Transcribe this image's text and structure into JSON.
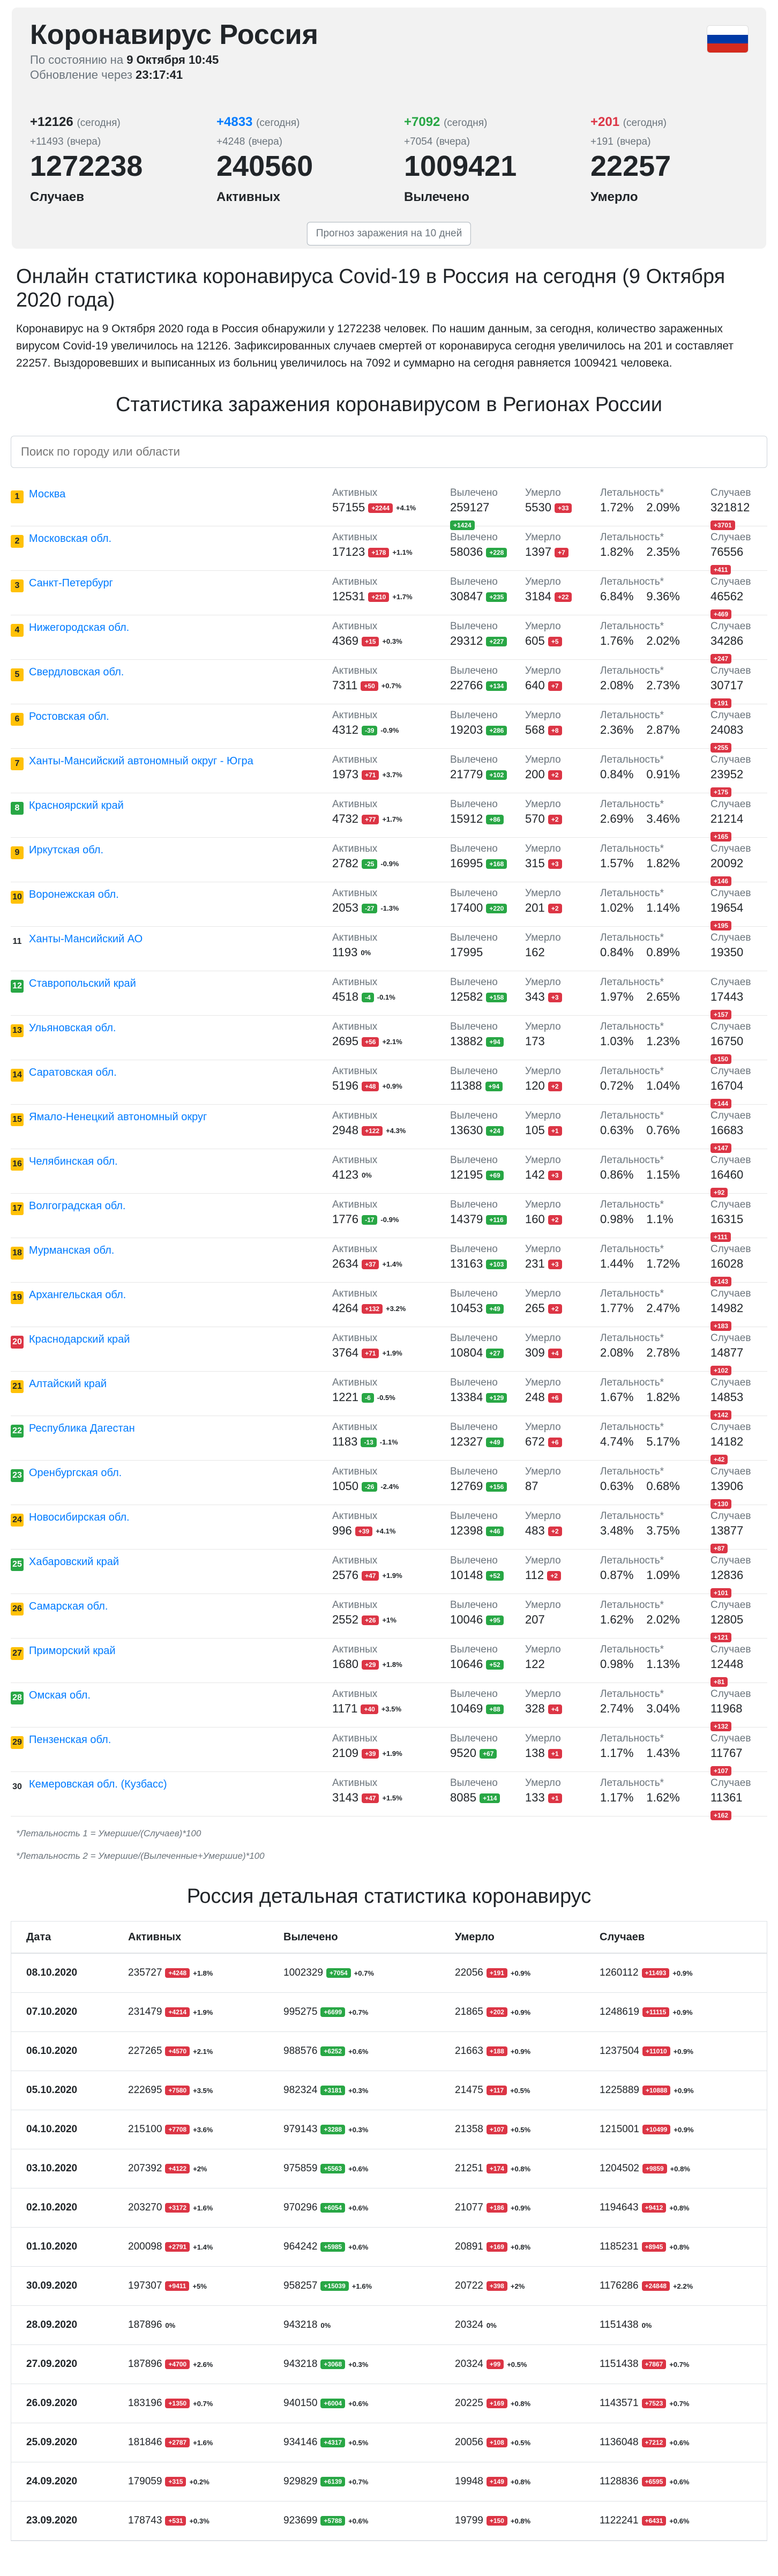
{
  "header": {
    "title": "Коронавирус Россия",
    "asof_prefix": "По состоянию на",
    "asof_value": "9 Октября 10:45",
    "update_prefix": "Обновление через",
    "update_value": "23:17:41",
    "forecast_button": "Прогноз заражения на 10 дней"
  },
  "summary": [
    {
      "today": "+12126",
      "today_lbl": "(сегодня)",
      "yday": "+11493",
      "yday_lbl": "(вчера)",
      "total": "1272238",
      "label": "Случаев",
      "color": "dark"
    },
    {
      "today": "+4833",
      "today_lbl": "(сегодня)",
      "yday": "+4248",
      "yday_lbl": "(вчера)",
      "total": "240560",
      "label": "Активных",
      "color": "blue"
    },
    {
      "today": "+7092",
      "today_lbl": "(сегодня)",
      "yday": "+7054",
      "yday_lbl": "(вчера)",
      "total": "1009421",
      "label": "Вылечено",
      "color": "green"
    },
    {
      "today": "+201",
      "today_lbl": "(сегодня)",
      "yday": "+191",
      "yday_lbl": "(вчера)",
      "total": "22257",
      "label": "Умерло",
      "color": "red"
    }
  ],
  "article": {
    "heading": "Онлайн статистика коронавируса Covid-19 в Россия на сегодня (9 Октября 2020 года)",
    "body": "Коронавирус на 9 Октября 2020 года в Россия обнаружили у 1272238 человек. По нашим данным, за сегодня, количество зараженных вирусом Covid-19 увеличилось на 12126. Зафиксированных случаев смертей от коронавируса сегодня увеличилось на 201 и составляет 22257. Выздоровевших и выписанных из больниц увеличилось на 7092 и суммарно на сегодня равняется 1009421 человека."
  },
  "regions_title": "Статистика заражения коронавирусом в Регионах России",
  "search": {
    "placeholder": "Поиск по городу или области"
  },
  "region_headers": {
    "active": "Активных",
    "recovered": "Вылечено",
    "deaths": "Умерло",
    "lethality": "Летальность*",
    "cases": "Случаев"
  },
  "regions": [
    {
      "n": "1",
      "name": "Москва",
      "active": "57155",
      "active_d": "+2244",
      "active_p": "+4.1%",
      "rec": "259127",
      "rec_d": "+1424",
      "deaths": "5530",
      "deaths_d": "+33",
      "l1": "1.72%",
      "l2": "2.09%",
      "cases": "321812",
      "cases_d": "+3701",
      "badge": "yellow"
    },
    {
      "n": "2",
      "name": "Московская обл.",
      "active": "17123",
      "active_d": "+178",
      "active_p": "+1.1%",
      "rec": "58036",
      "rec_d": "+228",
      "deaths": "1397",
      "deaths_d": "+7",
      "l1": "1.82%",
      "l2": "2.35%",
      "cases": "76556",
      "cases_d": "+411",
      "badge": "yellow"
    },
    {
      "n": "3",
      "name": "Санкт-Петербург",
      "active": "12531",
      "active_d": "+210",
      "active_p": "+1.7%",
      "rec": "30847",
      "rec_d": "+235",
      "deaths": "3184",
      "deaths_d": "+22",
      "l1": "6.84%",
      "l2": "9.36%",
      "cases": "46562",
      "cases_d": "+469",
      "badge": "yellow"
    },
    {
      "n": "4",
      "name": "Нижегородская обл.",
      "active": "4369",
      "active_d": "+15",
      "active_p": "+0.3%",
      "rec": "29312",
      "rec_d": "+227",
      "deaths": "605",
      "deaths_d": "+5",
      "l1": "1.76%",
      "l2": "2.02%",
      "cases": "34286",
      "cases_d": "+247",
      "badge": "yellow"
    },
    {
      "n": "5",
      "name": "Свердловская обл.",
      "active": "7311",
      "active_d": "+50",
      "active_p": "+0.7%",
      "rec": "22766",
      "rec_d": "+134",
      "deaths": "640",
      "deaths_d": "+7",
      "l1": "2.08%",
      "l2": "2.73%",
      "cases": "30717",
      "cases_d": "+191",
      "badge": "yellow"
    },
    {
      "n": "6",
      "name": "Ростовская обл.",
      "active": "4312",
      "active_d": "-39",
      "active_p": "-0.9%",
      "rec": "19203",
      "rec_d": "+286",
      "deaths": "568",
      "deaths_d": "+8",
      "l1": "2.36%",
      "l2": "2.87%",
      "cases": "24083",
      "cases_d": "+255",
      "badge": "yellow"
    },
    {
      "n": "7",
      "name": "Ханты-Мансийский автономный округ - Югра",
      "active": "1973",
      "active_d": "+71",
      "active_p": "+3.7%",
      "rec": "21779",
      "rec_d": "+102",
      "deaths": "200",
      "deaths_d": "+2",
      "l1": "0.84%",
      "l2": "0.91%",
      "cases": "23952",
      "cases_d": "+175",
      "badge": "yellow"
    },
    {
      "n": "8",
      "name": "Красноярский край",
      "active": "4732",
      "active_d": "+77",
      "active_p": "+1.7%",
      "rec": "15912",
      "rec_d": "+86",
      "deaths": "570",
      "deaths_d": "+2",
      "l1": "2.69%",
      "l2": "3.46%",
      "cases": "21214",
      "cases_d": "+165",
      "badge": "green"
    },
    {
      "n": "9",
      "name": "Иркутская обл.",
      "active": "2782",
      "active_d": "-25",
      "active_p": "-0.9%",
      "rec": "16995",
      "rec_d": "+168",
      "deaths": "315",
      "deaths_d": "+3",
      "l1": "1.57%",
      "l2": "1.82%",
      "cases": "20092",
      "cases_d": "+146",
      "badge": "yellow"
    },
    {
      "n": "10",
      "name": "Воронежская обл.",
      "active": "2053",
      "active_d": "-27",
      "active_p": "-1.3%",
      "rec": "17400",
      "rec_d": "+220",
      "deaths": "201",
      "deaths_d": "+2",
      "l1": "1.02%",
      "l2": "1.14%",
      "cases": "19654",
      "cases_d": "+195",
      "badge": "yellow"
    },
    {
      "n": "11",
      "name": "Ханты-Мансийский АО",
      "active": "1193",
      "active_d": "",
      "active_p": "0%",
      "rec": "17995",
      "rec_d": "",
      "deaths": "162",
      "deaths_d": "",
      "l1": "0.84%",
      "l2": "0.89%",
      "cases": "19350",
      "cases_d": "",
      "badge": "none"
    },
    {
      "n": "12",
      "name": "Ставропольский край",
      "active": "4518",
      "active_d": "-4",
      "active_p": "-0.1%",
      "rec": "12582",
      "rec_d": "+158",
      "deaths": "343",
      "deaths_d": "+3",
      "l1": "1.97%",
      "l2": "2.65%",
      "cases": "17443",
      "cases_d": "+157",
      "badge": "green"
    },
    {
      "n": "13",
      "name": "Ульяновская обл.",
      "active": "2695",
      "active_d": "+56",
      "active_p": "+2.1%",
      "rec": "13882",
      "rec_d": "+94",
      "deaths": "173",
      "deaths_d": "",
      "l1": "1.03%",
      "l2": "1.23%",
      "cases": "16750",
      "cases_d": "+150",
      "badge": "yellow"
    },
    {
      "n": "14",
      "name": "Саратовская обл.",
      "active": "5196",
      "active_d": "+48",
      "active_p": "+0.9%",
      "rec": "11388",
      "rec_d": "+94",
      "deaths": "120",
      "deaths_d": "+2",
      "l1": "0.72%",
      "l2": "1.04%",
      "cases": "16704",
      "cases_d": "+144",
      "badge": "yellow"
    },
    {
      "n": "15",
      "name": "Ямало-Ненецкий автономный округ",
      "active": "2948",
      "active_d": "+122",
      "active_p": "+4.3%",
      "rec": "13630",
      "rec_d": "+24",
      "deaths": "105",
      "deaths_d": "+1",
      "l1": "0.63%",
      "l2": "0.76%",
      "cases": "16683",
      "cases_d": "+147",
      "badge": "yellow"
    },
    {
      "n": "16",
      "name": "Челябинская обл.",
      "active": "4123",
      "active_d": "",
      "active_p": "0%",
      "rec": "12195",
      "rec_d": "+69",
      "deaths": "142",
      "deaths_d": "+3",
      "l1": "0.86%",
      "l2": "1.15%",
      "cases": "16460",
      "cases_d": "+92",
      "badge": "yellow"
    },
    {
      "n": "17",
      "name": "Волгоградская обл.",
      "active": "1776",
      "active_d": "-17",
      "active_p": "-0.9%",
      "rec": "14379",
      "rec_d": "+116",
      "deaths": "160",
      "deaths_d": "+2",
      "l1": "0.98%",
      "l2": "1.1%",
      "cases": "16315",
      "cases_d": "+111",
      "badge": "yellow"
    },
    {
      "n": "18",
      "name": "Мурманская обл.",
      "active": "2634",
      "active_d": "+37",
      "active_p": "+1.4%",
      "rec": "13163",
      "rec_d": "+103",
      "deaths": "231",
      "deaths_d": "+3",
      "l1": "1.44%",
      "l2": "1.72%",
      "cases": "16028",
      "cases_d": "+143",
      "badge": "yellow"
    },
    {
      "n": "19",
      "name": "Архангельская обл.",
      "active": "4264",
      "active_d": "+132",
      "active_p": "+3.2%",
      "rec": "10453",
      "rec_d": "+49",
      "deaths": "265",
      "deaths_d": "+2",
      "l1": "1.77%",
      "l2": "2.47%",
      "cases": "14982",
      "cases_d": "+183",
      "badge": "yellow"
    },
    {
      "n": "20",
      "name": "Краснодарский край",
      "active": "3764",
      "active_d": "+71",
      "active_p": "+1.9%",
      "rec": "10804",
      "rec_d": "+27",
      "deaths": "309",
      "deaths_d": "+4",
      "l1": "2.08%",
      "l2": "2.78%",
      "cases": "14877",
      "cases_d": "+102",
      "badge": "red"
    },
    {
      "n": "21",
      "name": "Алтайский край",
      "active": "1221",
      "active_d": "-6",
      "active_p": "-0.5%",
      "rec": "13384",
      "rec_d": "+129",
      "deaths": "248",
      "deaths_d": "+6",
      "l1": "1.67%",
      "l2": "1.82%",
      "cases": "14853",
      "cases_d": "+142",
      "badge": "yellow"
    },
    {
      "n": "22",
      "name": "Республика Дагестан",
      "active": "1183",
      "active_d": "-13",
      "active_p": "-1.1%",
      "rec": "12327",
      "rec_d": "+49",
      "deaths": "672",
      "deaths_d": "+6",
      "l1": "4.74%",
      "l2": "5.17%",
      "cases": "14182",
      "cases_d": "+42",
      "badge": "green"
    },
    {
      "n": "23",
      "name": "Оренбургская обл.",
      "active": "1050",
      "active_d": "-26",
      "active_p": "-2.4%",
      "rec": "12769",
      "rec_d": "+156",
      "deaths": "87",
      "deaths_d": "",
      "l1": "0.63%",
      "l2": "0.68%",
      "cases": "13906",
      "cases_d": "+130",
      "badge": "green"
    },
    {
      "n": "24",
      "name": "Новосибирская обл.",
      "active": "996",
      "active_d": "+39",
      "active_p": "+4.1%",
      "rec": "12398",
      "rec_d": "+46",
      "deaths": "483",
      "deaths_d": "+2",
      "l1": "3.48%",
      "l2": "3.75%",
      "cases": "13877",
      "cases_d": "+87",
      "badge": "yellow"
    },
    {
      "n": "25",
      "name": "Хабаровский край",
      "active": "2576",
      "active_d": "+47",
      "active_p": "+1.9%",
      "rec": "10148",
      "rec_d": "+52",
      "deaths": "112",
      "deaths_d": "+2",
      "l1": "0.87%",
      "l2": "1.09%",
      "cases": "12836",
      "cases_d": "+101",
      "badge": "green"
    },
    {
      "n": "26",
      "name": "Самарская обл.",
      "active": "2552",
      "active_d": "+26",
      "active_p": "+1%",
      "rec": "10046",
      "rec_d": "+95",
      "deaths": "207",
      "deaths_d": "",
      "l1": "1.62%",
      "l2": "2.02%",
      "cases": "12805",
      "cases_d": "+121",
      "badge": "yellow"
    },
    {
      "n": "27",
      "name": "Приморский край",
      "active": "1680",
      "active_d": "+29",
      "active_p": "+1.8%",
      "rec": "10646",
      "rec_d": "+52",
      "deaths": "122",
      "deaths_d": "",
      "l1": "0.98%",
      "l2": "1.13%",
      "cases": "12448",
      "cases_d": "+81",
      "badge": "yellow"
    },
    {
      "n": "28",
      "name": "Омская обл.",
      "active": "1171",
      "active_d": "+40",
      "active_p": "+3.5%",
      "rec": "10469",
      "rec_d": "+88",
      "deaths": "328",
      "deaths_d": "+4",
      "l1": "2.74%",
      "l2": "3.04%",
      "cases": "11968",
      "cases_d": "+132",
      "badge": "green"
    },
    {
      "n": "29",
      "name": "Пензенская обл.",
      "active": "2109",
      "active_d": "+39",
      "active_p": "+1.9%",
      "rec": "9520",
      "rec_d": "+67",
      "deaths": "138",
      "deaths_d": "+1",
      "l1": "1.17%",
      "l2": "1.43%",
      "cases": "11767",
      "cases_d": "+107",
      "badge": "yellow"
    },
    {
      "n": "30",
      "name": "Кемеровская обл. (Кузбасс)",
      "active": "3143",
      "active_d": "+47",
      "active_p": "+1.5%",
      "rec": "8085",
      "rec_d": "+114",
      "deaths": "133",
      "deaths_d": "+1",
      "l1": "1.17%",
      "l2": "1.62%",
      "cases": "11361",
      "cases_d": "+162",
      "badge": "none"
    }
  ],
  "notes": [
    "*Летальность 1 = Умершие/(Случаев)*100",
    "*Летальность 2 = Умершие/(Вылеченные+Умершие)*100"
  ],
  "daily_title": "Россия детальная статистика коронавирус",
  "daily_headers": {
    "date": "Дата",
    "active": "Активных",
    "rec": "Вылечено",
    "deaths": "Умерло",
    "cases": "Случаев"
  },
  "daily": [
    {
      "date": "08.10.2020",
      "a": "235727",
      "ad": "+4248",
      "ap": "+1.8%",
      "r": "1002329",
      "rd": "+7054",
      "rp": "+0.7%",
      "d": "22056",
      "dd": "+191",
      "dp": "+0.9%",
      "c": "1260112",
      "cd": "+11493",
      "cp": "+0.9%"
    },
    {
      "date": "07.10.2020",
      "a": "231479",
      "ad": "+4214",
      "ap": "+1.9%",
      "r": "995275",
      "rd": "+6699",
      "rp": "+0.7%",
      "d": "21865",
      "dd": "+202",
      "dp": "+0.9%",
      "c": "1248619",
      "cd": "+11115",
      "cp": "+0.9%"
    },
    {
      "date": "06.10.2020",
      "a": "227265",
      "ad": "+4570",
      "ap": "+2.1%",
      "r": "988576",
      "rd": "+6252",
      "rp": "+0.6%",
      "d": "21663",
      "dd": "+188",
      "dp": "+0.9%",
      "c": "1237504",
      "cd": "+11010",
      "cp": "+0.9%"
    },
    {
      "date": "05.10.2020",
      "a": "222695",
      "ad": "+7580",
      "ap": "+3.5%",
      "r": "982324",
      "rd": "+3181",
      "rp": "+0.3%",
      "d": "21475",
      "dd": "+117",
      "dp": "+0.5%",
      "c": "1225889",
      "cd": "+10888",
      "cp": "+0.9%"
    },
    {
      "date": "04.10.2020",
      "a": "215100",
      "ad": "+7708",
      "ap": "+3.6%",
      "r": "979143",
      "rd": "+3288",
      "rp": "+0.3%",
      "d": "21358",
      "dd": "+107",
      "dp": "+0.5%",
      "c": "1215001",
      "cd": "+10499",
      "cp": "+0.9%"
    },
    {
      "date": "03.10.2020",
      "a": "207392",
      "ad": "+4122",
      "ap": "+2%",
      "r": "975859",
      "rd": "+5563",
      "rp": "+0.6%",
      "d": "21251",
      "dd": "+174",
      "dp": "+0.8%",
      "c": "1204502",
      "cd": "+9859",
      "cp": "+0.8%"
    },
    {
      "date": "02.10.2020",
      "a": "203270",
      "ad": "+3172",
      "ap": "+1.6%",
      "r": "970296",
      "rd": "+6054",
      "rp": "+0.6%",
      "d": "21077",
      "dd": "+186",
      "dp": "+0.9%",
      "c": "1194643",
      "cd": "+9412",
      "cp": "+0.8%"
    },
    {
      "date": "01.10.2020",
      "a": "200098",
      "ad": "+2791",
      "ap": "+1.4%",
      "r": "964242",
      "rd": "+5985",
      "rp": "+0.6%",
      "d": "20891",
      "dd": "+169",
      "dp": "+0.8%",
      "c": "1185231",
      "cd": "+8945",
      "cp": "+0.8%"
    },
    {
      "date": "30.09.2020",
      "a": "197307",
      "ad": "+9411",
      "ap": "+5%",
      "r": "958257",
      "rd": "+15039",
      "rp": "+1.6%",
      "d": "20722",
      "dd": "+398",
      "dp": "+2%",
      "c": "1176286",
      "cd": "+24848",
      "cp": "+2.2%"
    },
    {
      "date": "28.09.2020",
      "a": "187896",
      "ad": "",
      "ap": "0%",
      "r": "943218",
      "rd": "",
      "rp": "0%",
      "d": "20324",
      "dd": "",
      "dp": "0%",
      "c": "1151438",
      "cd": "",
      "cp": "0%"
    },
    {
      "date": "27.09.2020",
      "a": "187896",
      "ad": "+4700",
      "ap": "+2.6%",
      "r": "943218",
      "rd": "+3068",
      "rp": "+0.3%",
      "d": "20324",
      "dd": "+99",
      "dp": "+0.5%",
      "c": "1151438",
      "cd": "+7867",
      "cp": "+0.7%"
    },
    {
      "date": "26.09.2020",
      "a": "183196",
      "ad": "+1350",
      "ap": "+0.7%",
      "r": "940150",
      "rd": "+6004",
      "rp": "+0.6%",
      "d": "20225",
      "dd": "+169",
      "dp": "+0.8%",
      "c": "1143571",
      "cd": "+7523",
      "cp": "+0.7%"
    },
    {
      "date": "25.09.2020",
      "a": "181846",
      "ad": "+2787",
      "ap": "+1.6%",
      "r": "934146",
      "rd": "+4317",
      "rp": "+0.5%",
      "d": "20056",
      "dd": "+108",
      "dp": "+0.5%",
      "c": "1136048",
      "cd": "+7212",
      "cp": "+0.6%"
    },
    {
      "date": "24.09.2020",
      "a": "179059",
      "ad": "+315",
      "ap": "+0.2%",
      "r": "929829",
      "rd": "+6139",
      "rp": "+0.7%",
      "d": "19948",
      "dd": "+149",
      "dp": "+0.8%",
      "c": "1128836",
      "cd": "+6595",
      "cp": "+0.6%"
    },
    {
      "date": "23.09.2020",
      "a": "178743",
      "ad": "+531",
      "ap": "+0.3%",
      "r": "923699",
      "rd": "+5788",
      "rp": "+0.6%",
      "d": "19799",
      "dd": "+150",
      "dp": "+0.8%",
      "c": "1122241",
      "cd": "+6431",
      "cp": "+0.6%"
    }
  ],
  "colors": {
    "badge_yellow": "#ffc107",
    "badge_green": "#28a745",
    "badge_red": "#dc3545",
    "pos": "#dc3545",
    "neg": "#28a745",
    "flag_white": "#ffffff",
    "flag_blue": "#0039a6",
    "flag_red": "#d52b1e"
  }
}
